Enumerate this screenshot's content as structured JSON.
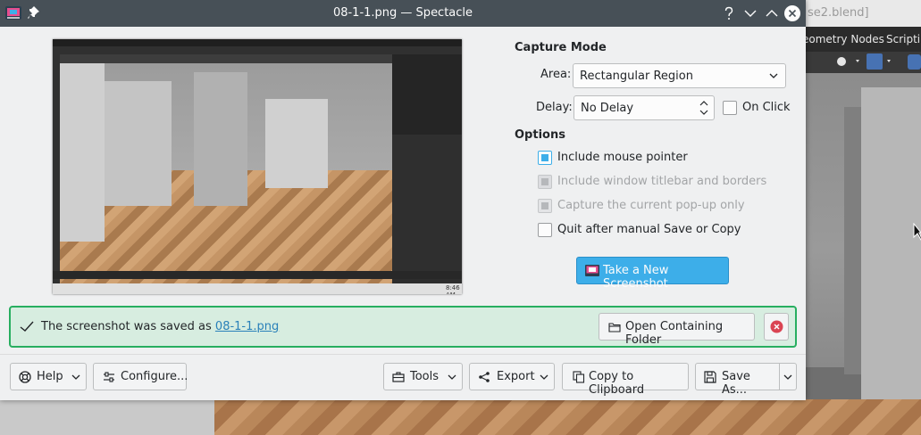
{
  "background": {
    "tab_text": "se2.blend]",
    "menu_items": [
      "eometry Nodes",
      "Scriptin"
    ]
  },
  "window": {
    "title": "08-1-1.png — Spectacle"
  },
  "preview": {
    "clock": "8:46 AM"
  },
  "capture_mode": {
    "heading": "Capture Mode",
    "area_label": "Area:",
    "area_value": "Rectangular Region",
    "delay_label": "Delay:",
    "delay_value": "No Delay",
    "on_click_label": "On Click",
    "on_click_checked": false
  },
  "options": {
    "heading": "Options",
    "items": [
      {
        "label": "Include mouse pointer",
        "checked": true,
        "enabled": true
      },
      {
        "label": "Include window titlebar and borders",
        "checked": true,
        "enabled": false
      },
      {
        "label": "Capture the current pop-up only",
        "checked": false,
        "enabled": false
      },
      {
        "label": "Quit after manual Save or Copy",
        "checked": false,
        "enabled": true
      }
    ]
  },
  "new_screenshot_label": "Take a New Screenshot",
  "message": {
    "text": "The screenshot was saved as ",
    "link": "08-1-1.png",
    "open_folder_label": "Open Containing Folder"
  },
  "toolbar": {
    "help_label": "Help",
    "configure_label": "Configure...",
    "tools_label": "Tools",
    "export_label": "Export",
    "copy_label": "Copy to Clipboard",
    "save_label": "Save As..."
  },
  "colors": {
    "accent": "#3daee9",
    "success": "#27ae60",
    "titlebar": "#475057",
    "error": "#da4453"
  }
}
